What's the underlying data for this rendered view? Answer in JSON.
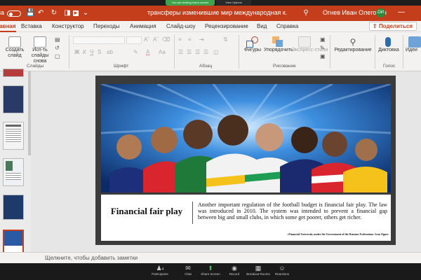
{
  "zoom_banner": {
    "sharing_text": "You are viewing Ivan's screen",
    "view_options": "View Options"
  },
  "titlebar": {
    "autosave_label": "на",
    "doc_title": "трансферы изменившие мир международная к...",
    "user_name": "Огнев Иван Олегович",
    "user_initials": "ОИ",
    "brand_color": "#c43e1c"
  },
  "tabs": {
    "items": [
      "Главная",
      "Вставка",
      "Конструктор",
      "Переходы",
      "Анимация",
      "Слайд-шоу",
      "Рецензирование",
      "Вид",
      "Справка"
    ],
    "active": "Главная",
    "share_label": "Поделиться"
  },
  "ribbon": {
    "slides_group": {
      "new_slide": "Создать слайд",
      "reuse_slides": "Исп-ть слайды снова",
      "group_label": "Слайды"
    },
    "font_group_label": "Шрифт",
    "paragraph_group_label": "Абзац",
    "drawing_group": {
      "shapes": "Фигуры",
      "arrange": "Упорядочить",
      "quick_styles": "Экспресс-стили",
      "group_label": "Рисование"
    },
    "editing": {
      "label": "Редактирование"
    },
    "voice": {
      "dictate": "Диктовка",
      "group_label": "Голос"
    },
    "designer": {
      "label": "Идеи"
    }
  },
  "slide": {
    "heading": "Financial fair play",
    "body": "Another important regulation of the football budget is financial fair play. The law was introduced in 2010. The system was intended to prevent a financial gap between big and small clubs, in which some get poorer, others get richer.",
    "footer": "«Financial University under the Government of the Russian Federation» Ivan Ognev"
  },
  "notes": {
    "placeholder": "Щелкните, чтобы добавить заметки"
  },
  "zoom_toolbar": {
    "items": [
      "Participants",
      "Chat",
      "Share Screen",
      "Record",
      "Breakout Rooms",
      "Reactions"
    ],
    "participants_count": "4"
  }
}
